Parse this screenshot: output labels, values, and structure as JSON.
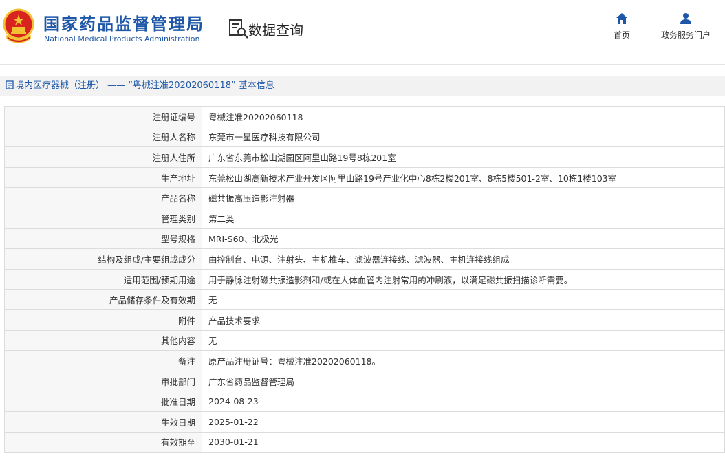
{
  "header": {
    "logo_cn": "国家药品监督管理局",
    "logo_en": "National Medical Products Administration",
    "search_title": "数据查询",
    "nav": [
      {
        "label": "首页",
        "icon": "home-icon"
      },
      {
        "label": "政务服务门户",
        "icon": "user-icon"
      }
    ]
  },
  "breadcrumb": {
    "text": "境内医疗器械（注册） —— “粤械注准20202060118” 基本信息"
  },
  "colors": {
    "brand_blue": "#1e57a8",
    "emblem_red": "#d8231f",
    "emblem_gold": "#f2c233"
  },
  "rows": [
    {
      "label": "注册证编号",
      "value": "粤械注准20202060118"
    },
    {
      "label": "注册人名称",
      "value": "东莞市一星医疗科技有限公司"
    },
    {
      "label": "注册人住所",
      "value": "广东省东莞市松山湖园区阿里山路19号8栋201室"
    },
    {
      "label": "生产地址",
      "value": "东莞松山湖高新技术产业开发区阿里山路19号产业化中心8栋2楼201室、8栋5楼501-2室、10栋1楼103室"
    },
    {
      "label": "产品名称",
      "value": "磁共振高压造影注射器"
    },
    {
      "label": "管理类别",
      "value": "第二类"
    },
    {
      "label": "型号规格",
      "value": "MRI-S60、北极光"
    },
    {
      "label": "结构及组成/主要组成成分",
      "value": "由控制台、电源、注射头、主机推车、滤波器连接线、滤波器、主机连接线组成。"
    },
    {
      "label": "适用范围/预期用途",
      "value": "用于静脉注射磁共振造影剂和/或在人体血管内注射常用的冲刷液，以满足磁共振扫描诊断需要。"
    },
    {
      "label": "产品储存条件及有效期",
      "value": "无"
    },
    {
      "label": "附件",
      "value": "产品技术要求"
    },
    {
      "label": "其他内容",
      "value": "无"
    },
    {
      "label": "备注",
      "value": "原产品注册证号：粤械注准20202060118。"
    },
    {
      "label": "审批部门",
      "value": "广东省药品监督管理局"
    },
    {
      "label": "批准日期",
      "value": "2024-08-23"
    },
    {
      "label": "生效日期",
      "value": "2025-01-22"
    },
    {
      "label": "有效期至",
      "value": "2030-01-21"
    }
  ]
}
